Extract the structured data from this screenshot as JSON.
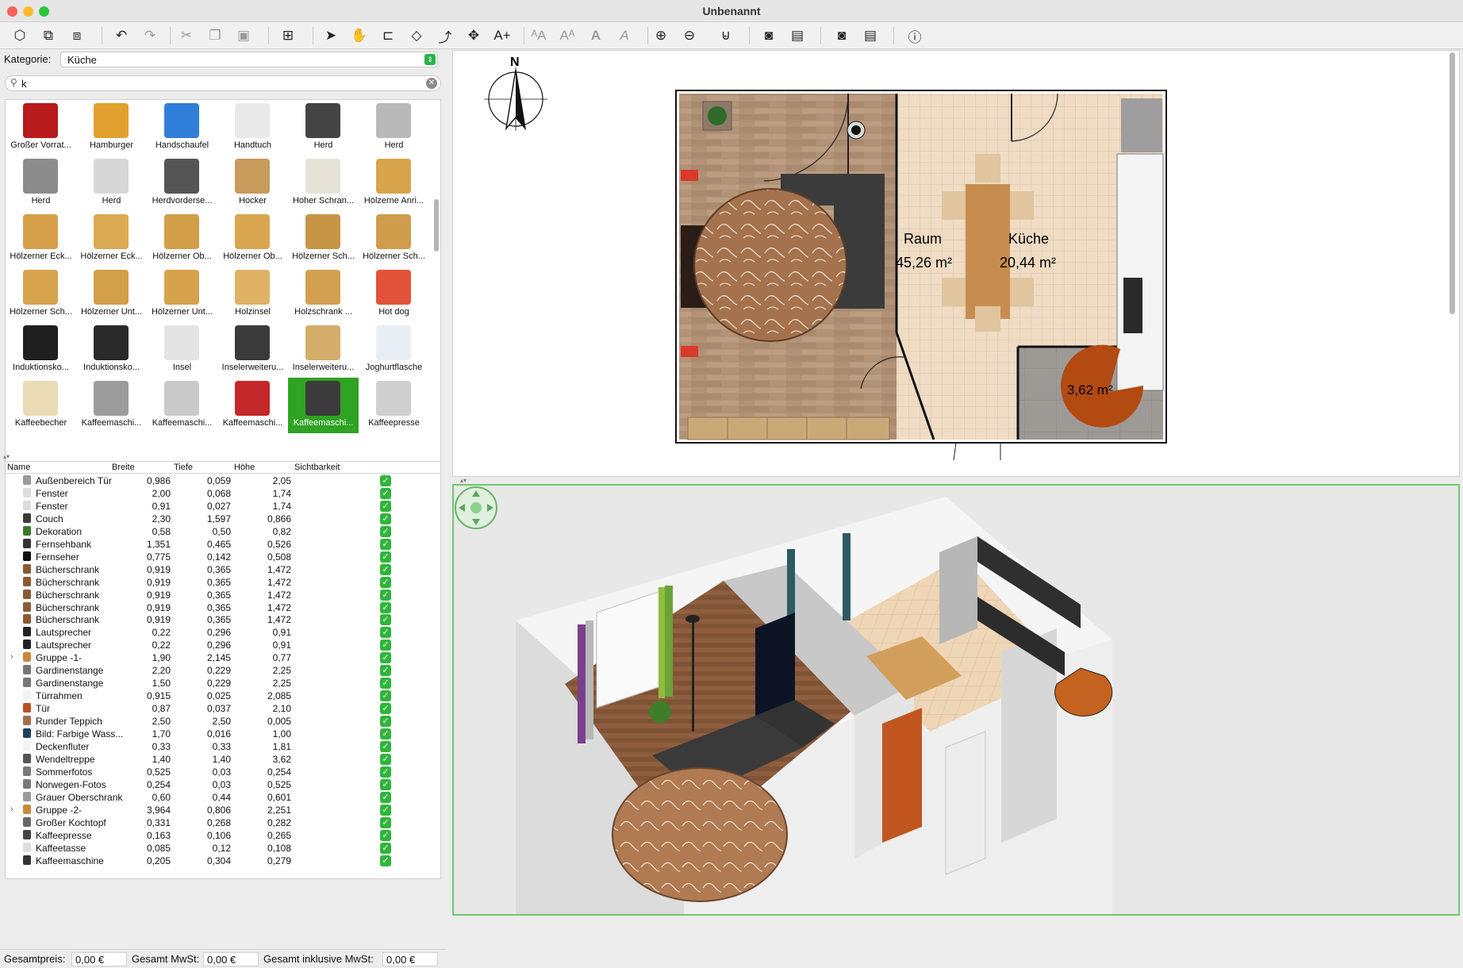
{
  "window": {
    "title": "Unbenannt"
  },
  "category": {
    "label": "Kategorie:",
    "value": "Küche"
  },
  "search": {
    "value": "k"
  },
  "catalog_items": [
    {
      "label": "Großer Vorrat...",
      "color": "#b81b1b"
    },
    {
      "label": "Hamburger",
      "color": "#e2a12e"
    },
    {
      "label": "Handschaufel",
      "color": "#2f7fd9"
    },
    {
      "label": "Handtuch",
      "color": "#e9e9e9"
    },
    {
      "label": "Herd",
      "color": "#444444"
    },
    {
      "label": "Herd",
      "color": "#b9b9b9"
    },
    {
      "label": "Herd",
      "color": "#8c8c8c"
    },
    {
      "label": "Herd",
      "color": "#d7d7d7"
    },
    {
      "label": "Herdvorderse...",
      "color": "#555555"
    },
    {
      "label": "Hocker",
      "color": "#c89a5b"
    },
    {
      "label": "Hoher Schran...",
      "color": "#e7e2d8"
    },
    {
      "label": "Hölzerne Anri...",
      "color": "#d9a54c"
    },
    {
      "label": "Hölzerner Eck...",
      "color": "#d6a04a"
    },
    {
      "label": "Hölzerner Eck...",
      "color": "#dba951"
    },
    {
      "label": "Hölzerner Ob...",
      "color": "#d39e48"
    },
    {
      "label": "Hölzerner Ob...",
      "color": "#d9a54f"
    },
    {
      "label": "Hölzerner Sch...",
      "color": "#c89546"
    },
    {
      "label": "Hölzerner Sch...",
      "color": "#cf9c4b"
    },
    {
      "label": "Hölzerner Sch...",
      "color": "#d7a34d"
    },
    {
      "label": "Hölzerner Unt...",
      "color": "#d29f4a"
    },
    {
      "label": "Hölzerner Unt...",
      "color": "#d6a24c"
    },
    {
      "label": "Holzinsel",
      "color": "#e0b265"
    },
    {
      "label": "Holzschrank ...",
      "color": "#d2a050"
    },
    {
      "label": "Hot dog",
      "color": "#e2533a"
    },
    {
      "label": "Induktionsko...",
      "color": "#1f1f1f"
    },
    {
      "label": "Induktionsko...",
      "color": "#2a2a2a"
    },
    {
      "label": "Insel",
      "color": "#e4e4e4"
    },
    {
      "label": "Inselerweiteru...",
      "color": "#3a3a3a"
    },
    {
      "label": "Inselerweiteru...",
      "color": "#d4ad6a"
    },
    {
      "label": "Joghurtflasche",
      "color": "#e9eef5"
    },
    {
      "label": "Kaffeebecher",
      "color": "#eadbb5"
    },
    {
      "label": "Kaffeemaschi...",
      "color": "#9c9c9c"
    },
    {
      "label": "Kaffeemaschi...",
      "color": "#c9c9c9"
    },
    {
      "label": "Kaffeemaschi...",
      "color": "#c5282b"
    },
    {
      "label": "Kaffeemaschi...",
      "color": "#3b3b3b"
    },
    {
      "label": "Kaffeepresse",
      "color": "#cfcfcf"
    }
  ],
  "furniture_table": {
    "headers": [
      "Name",
      "Breite",
      "Tiefe",
      "Höhe",
      "Sichtbarkeit"
    ],
    "rows": [
      {
        "name": "Außenbereich Tür",
        "w": "0,986",
        "d": "0,059",
        "h": "2,05",
        "icon": "#9a9a9a",
        "group": false
      },
      {
        "name": "Fenster",
        "w": "2,00",
        "d": "0,068",
        "h": "1,74",
        "icon": "#dcdcdc",
        "group": false
      },
      {
        "name": "Fenster",
        "w": "0,91",
        "d": "0,027",
        "h": "1,74",
        "icon": "#dcdcdc",
        "group": false
      },
      {
        "name": "Couch",
        "w": "2,30",
        "d": "1,597",
        "h": "0,866",
        "icon": "#3a3a3a",
        "group": false
      },
      {
        "name": "Dekoration",
        "w": "0,58",
        "d": "0,50",
        "h": "0,82",
        "icon": "#3c7a2c",
        "group": false
      },
      {
        "name": "Fernsehbank",
        "w": "1,351",
        "d": "0,465",
        "h": "0,526",
        "icon": "#333333",
        "group": false
      },
      {
        "name": "Fernseher",
        "w": "0,775",
        "d": "0,142",
        "h": "0,508",
        "icon": "#111111",
        "group": false
      },
      {
        "name": "Bücherschrank",
        "w": "0,919",
        "d": "0,365",
        "h": "1,472",
        "icon": "#8a5a32",
        "group": false
      },
      {
        "name": "Bücherschrank",
        "w": "0,919",
        "d": "0,365",
        "h": "1,472",
        "icon": "#8a5a32",
        "group": false
      },
      {
        "name": "Bücherschrank",
        "w": "0,919",
        "d": "0,365",
        "h": "1,472",
        "icon": "#8a5a32",
        "group": false
      },
      {
        "name": "Bücherschrank",
        "w": "0,919",
        "d": "0,365",
        "h": "1,472",
        "icon": "#8a5a32",
        "group": false
      },
      {
        "name": "Bücherschrank",
        "w": "0,919",
        "d": "0,365",
        "h": "1,472",
        "icon": "#8a5a32",
        "group": false
      },
      {
        "name": "Lautsprecher",
        "w": "0,22",
        "d": "0,296",
        "h": "0,91",
        "icon": "#222222",
        "group": false
      },
      {
        "name": "Lautsprecher",
        "w": "0,22",
        "d": "0,296",
        "h": "0,91",
        "icon": "#222222",
        "group": false
      },
      {
        "name": "Gruppe -1-",
        "w": "1,90",
        "d": "2,145",
        "h": "0,77",
        "icon": "#c58a3c",
        "group": true
      },
      {
        "name": "Gardinenstange",
        "w": "2,20",
        "d": "0,229",
        "h": "2,25",
        "icon": "#777777",
        "group": false
      },
      {
        "name": "Gardinenstange",
        "w": "1,50",
        "d": "0,229",
        "h": "2,25",
        "icon": "#777777",
        "group": false
      },
      {
        "name": "Türrahmen",
        "w": "0,915",
        "d": "0,025",
        "h": "2,085",
        "icon": "#f2f2f2",
        "group": false
      },
      {
        "name": "Tür",
        "w": "0,87",
        "d": "0,037",
        "h": "2,10",
        "icon": "#b5551e",
        "group": false
      },
      {
        "name": "Runder Teppich",
        "w": "2,50",
        "d": "2,50",
        "h": "0,005",
        "icon": "#a0704a",
        "group": false
      },
      {
        "name": "Bild: Farbige Wass...",
        "w": "1,70",
        "d": "0,016",
        "h": "1,00",
        "icon": "#1f3f5f",
        "group": false
      },
      {
        "name": "Deckenfluter",
        "w": "0,33",
        "d": "0,33",
        "h": "1,81",
        "icon": "#f2f2f2",
        "group": false
      },
      {
        "name": "Wendeltreppe",
        "w": "1,40",
        "d": "1,40",
        "h": "3,62",
        "icon": "#555555",
        "group": false
      },
      {
        "name": "Sommerfotos",
        "w": "0,525",
        "d": "0,03",
        "h": "0,254",
        "icon": "#7a7a7a",
        "group": false
      },
      {
        "name": "Norwegen-Fotos",
        "w": "0,254",
        "d": "0,03",
        "h": "0,525",
        "icon": "#7a7a7a",
        "group": false
      },
      {
        "name": "Grauer Oberschrank",
        "w": "0,60",
        "d": "0,44",
        "h": "0,601",
        "icon": "#9a9a9a",
        "group": false
      },
      {
        "name": "Gruppe -2-",
        "w": "3,964",
        "d": "0,806",
        "h": "2,251",
        "icon": "#c58a3c",
        "group": true
      },
      {
        "name": "Großer Kochtopf",
        "w": "0,331",
        "d": "0,268",
        "h": "0,282",
        "icon": "#666666",
        "group": false
      },
      {
        "name": "Kaffeepresse",
        "w": "0,163",
        "d": "0,106",
        "h": "0,265",
        "icon": "#444444",
        "group": false
      },
      {
        "name": "Kaffeetasse",
        "w": "0,085",
        "d": "0,12",
        "h": "0,108",
        "icon": "#dddddd",
        "group": false
      },
      {
        "name": "Kaffeemaschine",
        "w": "0,205",
        "d": "0,304",
        "h": "0,279",
        "icon": "#333333",
        "group": false
      }
    ]
  },
  "status": {
    "total_label": "Gesamtpreis:",
    "total": "0,00 €",
    "vat_label": "Gesamt MwSt:",
    "vat": "0,00 €",
    "incl_label": "Gesamt inklusive MwSt:",
    "incl": "0,00 €"
  },
  "plan": {
    "compass_letter": "N",
    "rooms": [
      {
        "name": "Raum",
        "area": "45,26 m²"
      },
      {
        "name": "Küche",
        "area": "20,44 m²"
      },
      {
        "name": "",
        "area": "3,62 m²"
      }
    ]
  },
  "colors": {
    "accent": "#2fa323",
    "check": "#2fb53a",
    "view_border": "#6ec96c"
  }
}
